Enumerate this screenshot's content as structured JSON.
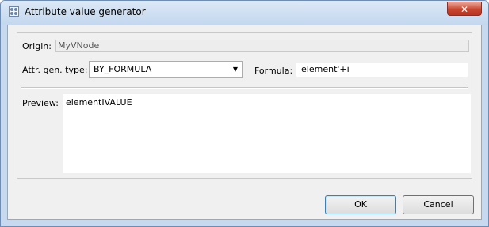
{
  "window": {
    "title": "Attribute value generator",
    "close_glyph": "✕"
  },
  "origin": {
    "label": "Origin:",
    "value": "MyVNode"
  },
  "attr_gen_type": {
    "label": "Attr. gen. type:",
    "value": "BY_FORMULA"
  },
  "formula": {
    "label": "Formula:",
    "value": "'element'+i"
  },
  "preview": {
    "label": "Preview:",
    "value": "elementIVALUE"
  },
  "buttons": {
    "ok": "OK",
    "cancel": "Cancel"
  },
  "icons": {
    "app": "app-icon",
    "dropdown": "chevron-down-icon",
    "close": "close-icon"
  },
  "colors": {
    "titlebar": "#c6d9ee",
    "close_button": "#c9462f",
    "default_button_border": "#3c7fb1"
  }
}
